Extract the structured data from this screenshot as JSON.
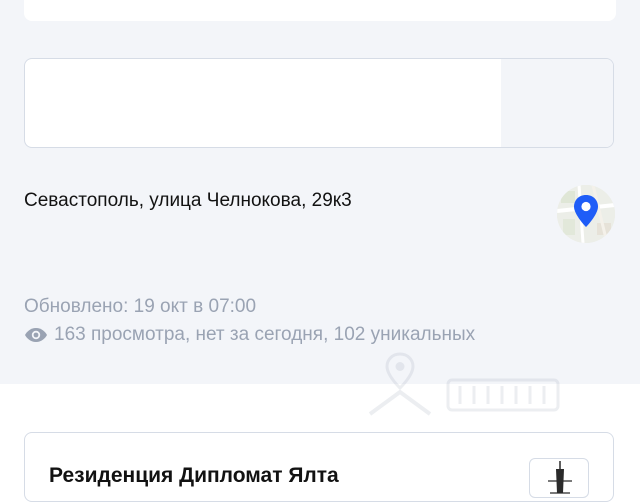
{
  "listing": {
    "address": "Севастополь, улица Челнокова, 29к3",
    "updated": "Обновлено: 19 окт в 07:00",
    "views": "163 просмотра, нет за сегодня, 102 уникальных"
  },
  "icons": {
    "map": "map-pin-icon",
    "views": "eye-icon",
    "watermark": "cian-watermark-icon",
    "developer_logo": "building-logo-icon"
  },
  "residential_complex": {
    "name": "Резиденция Дипломат Ялта"
  },
  "colors": {
    "page_bg": "#f3f5f9",
    "muted_text": "#9aa3b3",
    "pin": "#1f5df7",
    "border": "#d6dce6"
  }
}
